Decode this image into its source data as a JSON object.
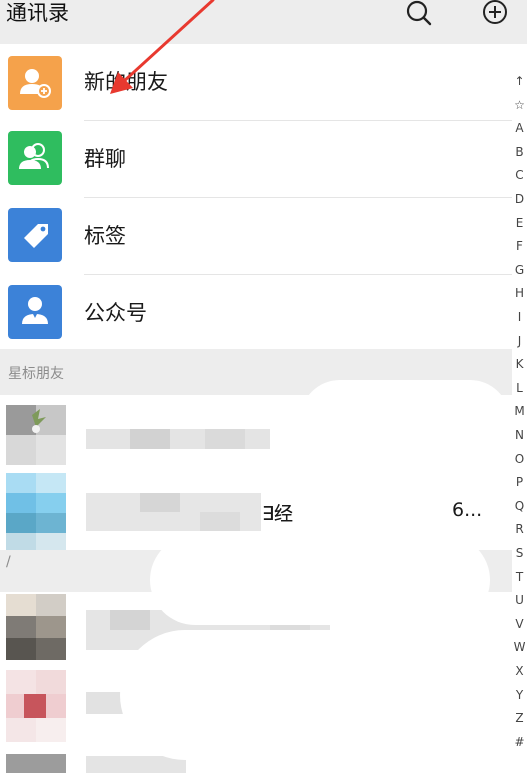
{
  "header": {
    "title": "通讯录",
    "search_icon": "search-icon",
    "add_icon": "plus-circle-icon"
  },
  "entries": [
    {
      "label": "新的朋友",
      "icon": "add-friend-icon",
      "color": "#f5a24b"
    },
    {
      "label": "群聊",
      "icon": "group-chat-icon",
      "color": "#2fbd5f"
    },
    {
      "label": "标签",
      "icon": "tag-icon",
      "color": "#3c82d8"
    },
    {
      "label": "公众号",
      "icon": "official-account-icon",
      "color": "#3c82d8"
    }
  ],
  "starred_section": {
    "label": "星标朋友"
  },
  "contacts": [
    {
      "name_visible": ""
    },
    {
      "name_visible": "∃经",
      "suffix": "6..."
    },
    {
      "name_visible": ""
    },
    {
      "name_visible": ""
    }
  ],
  "section_mark": "/",
  "index": [
    "↑",
    "☆",
    "A",
    "B",
    "C",
    "D",
    "E",
    "F",
    "G",
    "H",
    "I",
    "J",
    "K",
    "L",
    "M",
    "N",
    "O",
    "P",
    "Q",
    "R",
    "S",
    "T",
    "U",
    "V",
    "W",
    "X",
    "Y",
    "Z",
    "#"
  ],
  "annotation": {
    "arrow_color": "#e8392f"
  }
}
